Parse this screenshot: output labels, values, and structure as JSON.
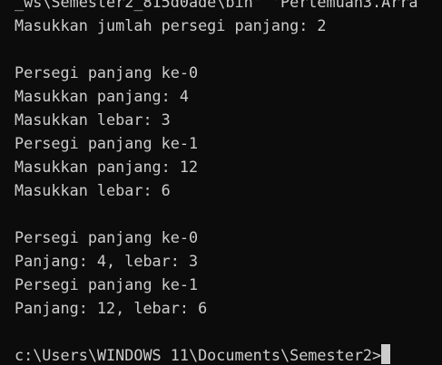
{
  "terminal": {
    "lines": [
      "_ws\\Semester2_815d0ade\\bin' 'Pertemuan3.Arra",
      "Masukkan jumlah persegi panjang: 2",
      "",
      "Persegi panjang ke-0",
      "Masukkan panjang: 4",
      "Masukkan lebar: 3",
      "Persegi panjang ke-1",
      "Masukkan panjang: 12",
      "Masukkan lebar: 6",
      "",
      "Persegi panjang ke-0",
      "Panjang: 4, lebar: 3",
      "Persegi panjang ke-1",
      "Panjang: 12, lebar: 6",
      ""
    ],
    "prompt": "c:\\Users\\WINDOWS 11\\Documents\\Semester2>",
    "colors": {
      "background": "#0c0c0c",
      "foreground": "#cccccc",
      "cursor": "#cccccc"
    }
  }
}
